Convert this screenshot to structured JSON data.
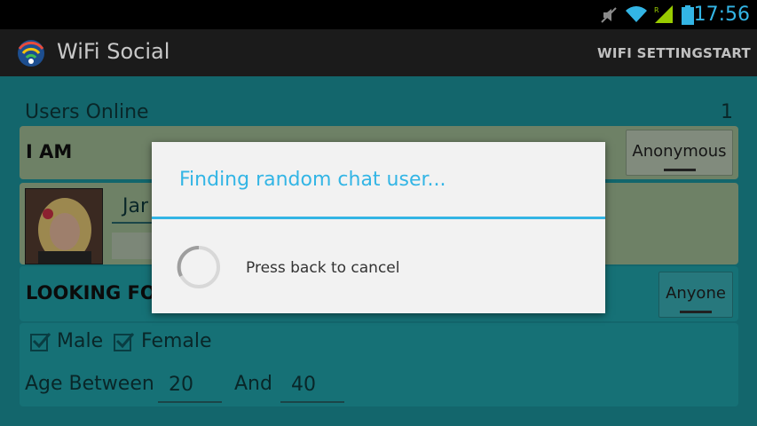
{
  "status_bar": {
    "time": "17:56"
  },
  "action_bar": {
    "app_title": "WiFi Social",
    "actions": [
      "WIFI SETTING",
      "START"
    ]
  },
  "main": {
    "users_online_label": "Users Online",
    "users_online_count": "1",
    "i_am_label": "I AM",
    "i_am_button": "Anonymous",
    "name_partial": "Jar",
    "looking_for_label": "LOOKING FO",
    "looking_for_button": "Anyone",
    "gender_options": [
      {
        "label": "Male",
        "checked": true
      },
      {
        "label": "Female",
        "checked": true
      }
    ],
    "age_between_label": "Age Between",
    "age_min": "20",
    "and_label": "And",
    "age_max": "40"
  },
  "dialog": {
    "title": "Finding random chat user...",
    "message": "Press back to cancel"
  },
  "icons": {
    "app_logo": "wifi-social-logo-icon",
    "status": [
      "mute-icon",
      "wifi-icon",
      "signal-icon",
      "battery-icon"
    ]
  },
  "colors": {
    "accent": "#33b5e5",
    "content_bg": "#1e9da6",
    "panel_green": "#a9c79d"
  }
}
